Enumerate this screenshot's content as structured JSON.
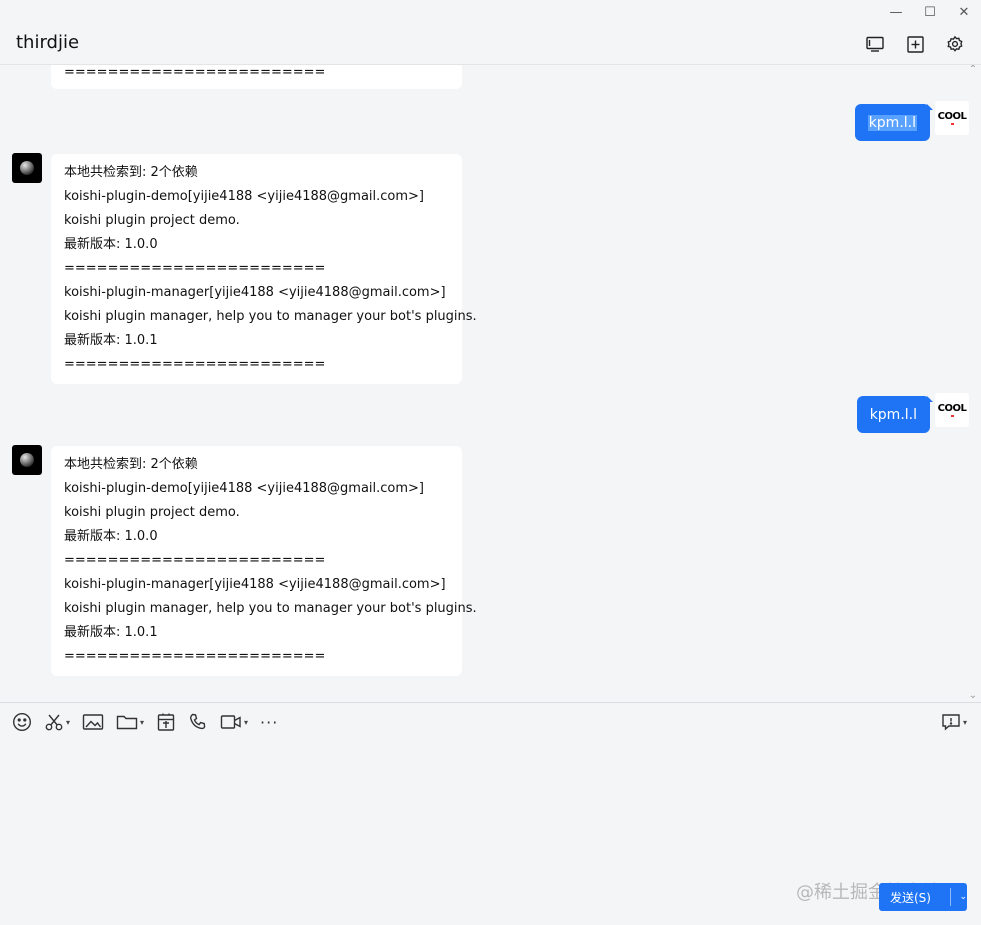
{
  "window": {
    "controls": [
      "—",
      "☐",
      "✕"
    ]
  },
  "header": {
    "title": "thirdjie",
    "icons": [
      "screen-share-icon",
      "add-window-icon",
      "settings-gear-icon"
    ]
  },
  "chat": {
    "top_fragment": "========================",
    "messages": [
      {
        "sender": "user",
        "text": "kpm.l.l",
        "selected": true
      },
      {
        "sender": "bot",
        "lines": [
          "本地共检索到: 2个依赖",
          "koishi-plugin-demo[yijie4188 <yijie4188@gmail.com>]",
          "koishi plugin project demo.",
          "最新版本: 1.0.0",
          "========================",
          "koishi-plugin-manager[yijie4188 <yijie4188@gmail.com>]",
          "koishi plugin manager, help you to manager your bot's plugins.",
          "最新版本: 1.0.1",
          "========================"
        ]
      },
      {
        "sender": "user",
        "text": "kpm.l.l",
        "selected": false
      },
      {
        "sender": "bot",
        "lines": [
          "本地共检索到: 2个依赖",
          "koishi-plugin-demo[yijie4188 <yijie4188@gmail.com>]",
          "koishi plugin project demo.",
          "最新版本: 1.0.0",
          "========================",
          "koishi-plugin-manager[yijie4188 <yijie4188@gmail.com>]",
          "koishi plugin manager, help you to manager your bot's plugins.",
          "最新版本: 1.0.1",
          "========================"
        ]
      }
    ],
    "user_avatar_text": "COOL",
    "scroll_up": "⌃",
    "scroll_down": "⌄"
  },
  "toolbar": {
    "items": [
      "emoji-icon",
      "scissors-icon",
      "image-icon",
      "folder-icon",
      "red-packet-icon",
      "phone-icon",
      "video-call-icon",
      "more-icon"
    ],
    "more_label": "···"
  },
  "send": {
    "label": "发送(S)",
    "chevron": "⌄"
  },
  "watermark": "@稀土掘金技术社区",
  "colors": {
    "accent": "#1e74f5",
    "background": "#f4f5f7",
    "bubble": "#ffffff"
  }
}
